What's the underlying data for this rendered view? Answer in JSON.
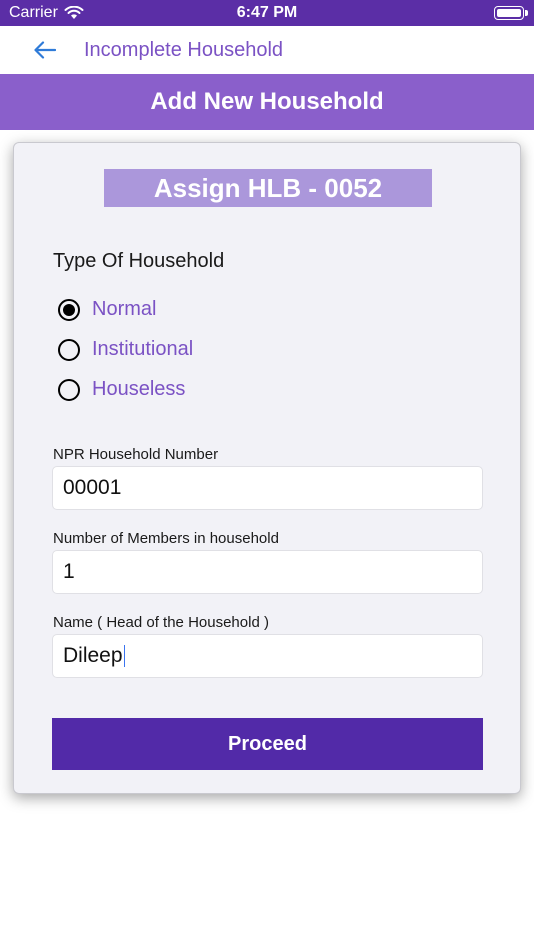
{
  "status_bar": {
    "carrier": "Carrier",
    "time": "6:47 PM"
  },
  "nav": {
    "back_icon": "arrow-left-icon",
    "title": "Incomplete Household"
  },
  "header": {
    "title": "Add New Household"
  },
  "form": {
    "hlb_label": "Assign HLB - 0052",
    "household_type": {
      "label": "Type Of Household",
      "options": [
        {
          "label": "Normal",
          "selected": true
        },
        {
          "label": "Institutional",
          "selected": false
        },
        {
          "label": "Houseless",
          "selected": false
        }
      ]
    },
    "npr_number": {
      "label": "NPR Household Number",
      "value": "00001"
    },
    "members": {
      "label": "Number of Members in household",
      "value": "1"
    },
    "head_name": {
      "label": "Name ( Head of the Household )",
      "value": "Dileep"
    },
    "proceed_label": "Proceed"
  },
  "colors": {
    "status_bar": "#5b2ea6",
    "header_band": "#8a5fcb",
    "accent_text": "#7b52c4",
    "badge": "#ab97db",
    "button": "#522aa8"
  }
}
